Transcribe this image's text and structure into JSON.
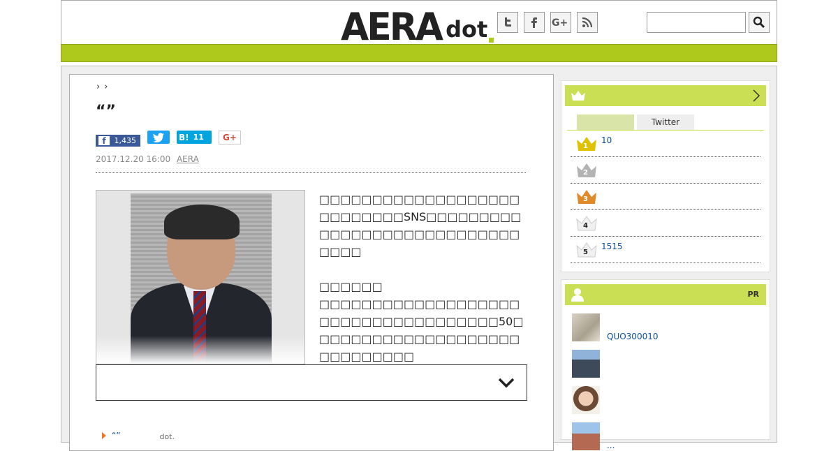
{
  "header": {
    "logo_main": "AERA",
    "logo_sub": "dot",
    "social_icons": [
      "twitter-icon",
      "facebook-icon",
      "google-plus-icon",
      "rss-icon"
    ],
    "search_value": "",
    "accent_color": "#afc81c"
  },
  "article": {
    "breadcrumb_separators": [
      "›",
      "›"
    ],
    "title": "“”",
    "share": {
      "facebook_count": "1,435",
      "hatena_label": "B!",
      "hatena_count": "11",
      "google_plus_label": "G+"
    },
    "date": "2017.12.20 16:00",
    "author": "AERA",
    "paragraphs": [
      "□□□□□□□□□□□□□□□□□□□□□□□□□□□SNS□□□□□□□□□□□□□□□□□□□□□□□□□□□□□□□□",
      "□□□□□□",
      "□□□□□□□□□□□□□□□□□□□□□□□□□□□□□□□□□□□□50□□□□□□□□□□□□□□□□□□□□□□□□□□□□□"
    ],
    "related": {
      "title": "“”",
      "source": "dot."
    }
  },
  "sidebar": {
    "ranking": {
      "tabs": [
        "",
        "Twitter"
      ],
      "items": [
        {
          "rank": "1",
          "text": "10",
          "color": "#e0c100"
        },
        {
          "rank": "2",
          "text": "",
          "color": "#b3b3b3"
        },
        {
          "rank": "3",
          "text": "",
          "color": "#e08a2a"
        },
        {
          "rank": "4",
          "text": "",
          "color": "#f0f0f0"
        },
        {
          "rank": "5",
          "text": "1515",
          "color": "#f0f0f0"
        }
      ]
    },
    "pr": {
      "label": "PR",
      "items": [
        {
          "text": "QUO300010"
        },
        {
          "text": ""
        },
        {
          "text": ""
        },
        {
          "text": "..."
        }
      ]
    }
  }
}
